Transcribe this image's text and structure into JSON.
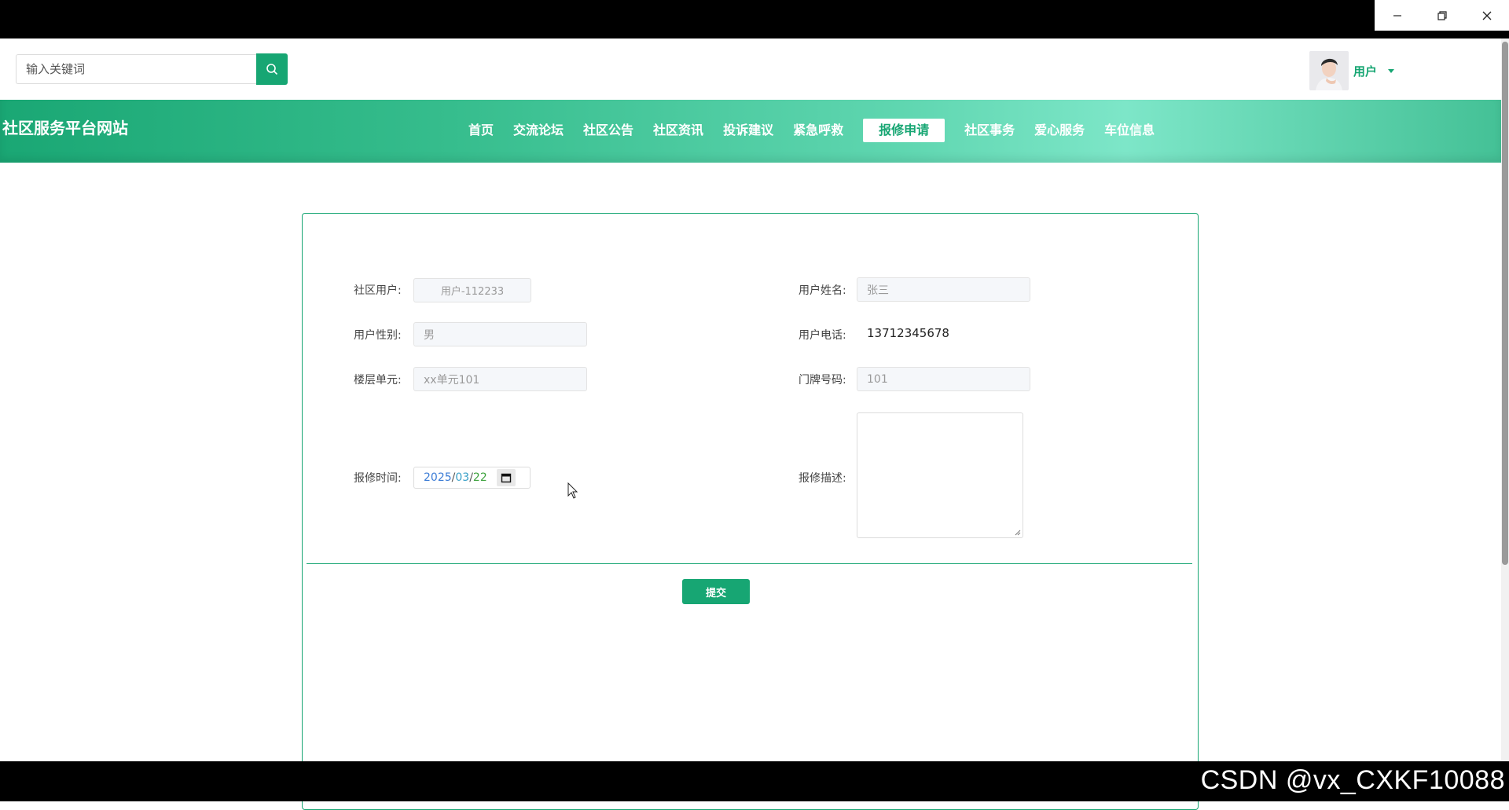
{
  "header": {
    "search_placeholder": "输入关键词",
    "user_label": "用户"
  },
  "nav": {
    "site_title": "社区服务平台网站",
    "items": [
      {
        "label": "首页",
        "active": false
      },
      {
        "label": "交流论坛",
        "active": false
      },
      {
        "label": "社区公告",
        "active": false
      },
      {
        "label": "社区资讯",
        "active": false
      },
      {
        "label": "投诉建议",
        "active": false
      },
      {
        "label": "紧急呼救",
        "active": false
      },
      {
        "label": "报修申请",
        "active": true
      },
      {
        "label": "社区事务",
        "active": false
      },
      {
        "label": "爱心服务",
        "active": false
      },
      {
        "label": "车位信息",
        "active": false
      }
    ]
  },
  "form": {
    "community_user": {
      "label": "社区用户:",
      "value": "用户-112233"
    },
    "user_name": {
      "label": "用户姓名:",
      "value": "张三"
    },
    "gender": {
      "label": "用户性别:",
      "value": "男"
    },
    "phone": {
      "label": "用户电话:",
      "value": "13712345678"
    },
    "floor_unit": {
      "label": "楼层单元:",
      "value": "xx单元101"
    },
    "door_number": {
      "label": "门牌号码:",
      "value": "101"
    },
    "repair_time": {
      "label": "报修时间:",
      "year": "2025",
      "month": "03",
      "day": "22",
      "separator": "/"
    },
    "repair_desc": {
      "label": "报修描述:",
      "value": ""
    },
    "submit_label": "提交"
  },
  "watermark": "CSDN @vx_CXKF10088",
  "colors": {
    "primary": "#17a673",
    "nav_gradient_light": "#7de6c8"
  }
}
